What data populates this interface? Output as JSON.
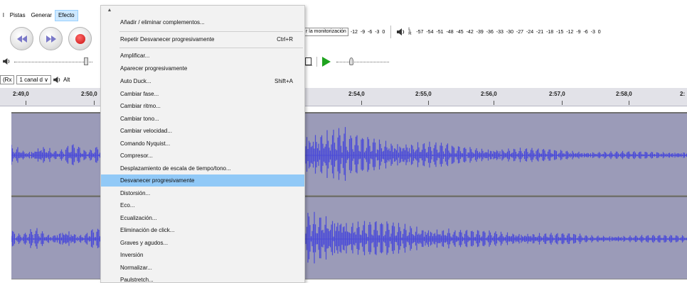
{
  "menubar": {
    "items": [
      {
        "label": "l"
      },
      {
        "label": "Pistas"
      },
      {
        "label": "Generar"
      },
      {
        "label": "Efecto"
      }
    ]
  },
  "meter": {
    "record_label": "r la monitorización",
    "record_scale": "-12 -9 -6 -3 0",
    "play_lr": "L R",
    "play_scale": "-57 -54 -51 -48 -45 -42 -39 -36 -33 -30 -27 -24 -21 -18 -15 -12 -9 -6 -3 0"
  },
  "device": {
    "host_label": "(Rx",
    "channels_label": "1 canal d",
    "output_label": "Alt"
  },
  "timeline": {
    "ticks": [
      "2:49,0",
      "2:50,0",
      "2:54,0",
      "2:55,0",
      "2:56,0",
      "2:57,0",
      "2:58,0",
      "2:"
    ]
  },
  "effect_menu": {
    "scroll_glyph": "▲",
    "items": [
      {
        "label": "Añadir / eliminar complementos...",
        "shortcut": ""
      },
      {
        "label": "Repetir Desvanecer progresivamente",
        "shortcut": "Ctrl+R"
      },
      {
        "label": "Amplificar...",
        "shortcut": ""
      },
      {
        "label": "Aparecer progresivamente",
        "shortcut": ""
      },
      {
        "label": "Auto Duck...",
        "shortcut": "Shift+A"
      },
      {
        "label": "Cambiar fase...",
        "shortcut": ""
      },
      {
        "label": "Cambiar ritmo...",
        "shortcut": ""
      },
      {
        "label": "Cambiar tono...",
        "shortcut": ""
      },
      {
        "label": "Cambiar velocidad...",
        "shortcut": ""
      },
      {
        "label": "Comando Nyquist...",
        "shortcut": ""
      },
      {
        "label": "Compresor...",
        "shortcut": ""
      },
      {
        "label": "Desplazamiento de escala de tiempo/tono...",
        "shortcut": ""
      },
      {
        "label": "Desvanecer progresivamente",
        "shortcut": ""
      },
      {
        "label": "Distorsión...",
        "shortcut": ""
      },
      {
        "label": "Eco...",
        "shortcut": ""
      },
      {
        "label": "Ecualización...",
        "shortcut": ""
      },
      {
        "label": "Eliminación de click...",
        "shortcut": ""
      },
      {
        "label": "Graves y agudos...",
        "shortcut": ""
      },
      {
        "label": "Inversión",
        "shortcut": ""
      },
      {
        "label": "Normalizar...",
        "shortcut": ""
      },
      {
        "label": "Paulstretch...",
        "shortcut": ""
      }
    ],
    "highlighted_item": "Desvanecer progresivamente"
  },
  "colors": {
    "waveform": "#4b4bd8",
    "track_bg": "#9b9bb8",
    "highlight": "#91c9f7"
  }
}
